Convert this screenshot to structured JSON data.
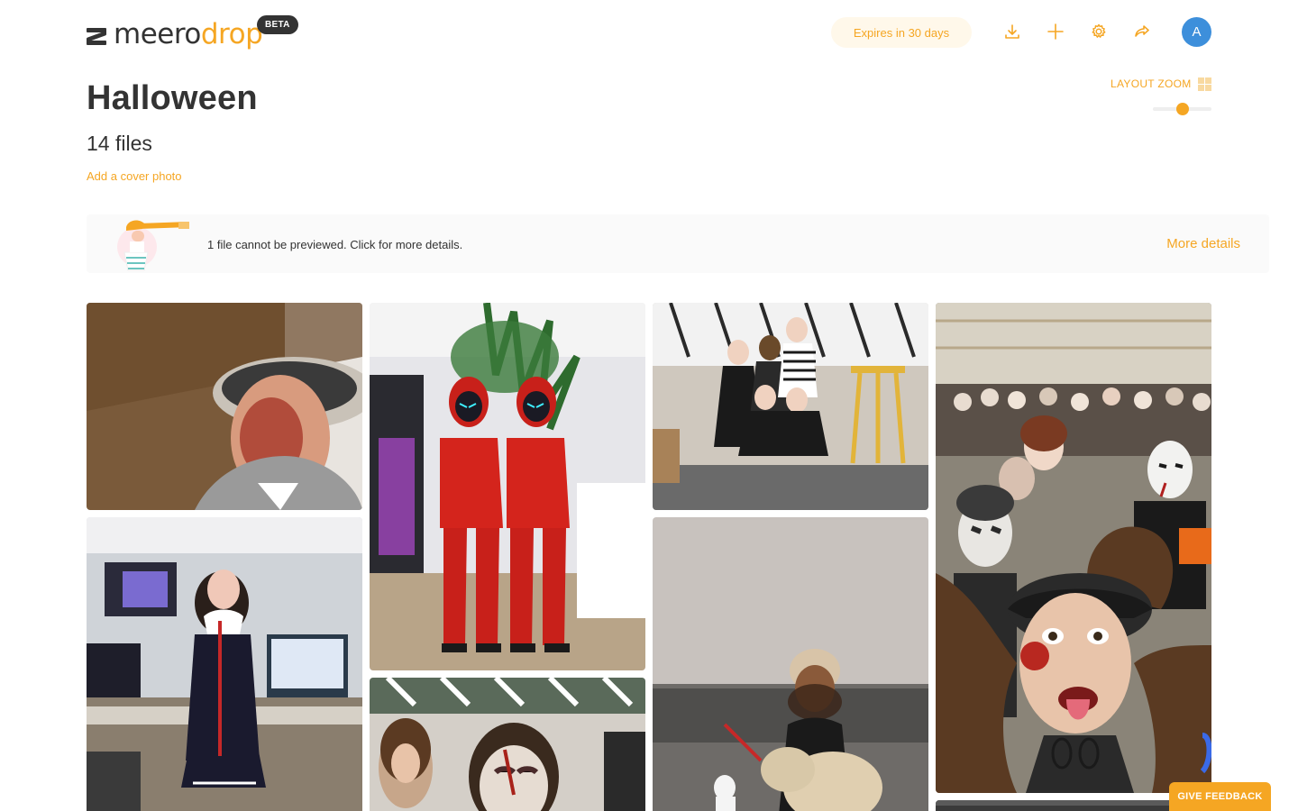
{
  "app": {
    "logo_primary": "meero",
    "logo_accent": "drop",
    "badge": "BETA"
  },
  "header": {
    "expires_label": "Expires in 30 days",
    "avatar_initial": "A",
    "icons": [
      "download-icon",
      "plus-icon",
      "settings-gear-icon",
      "share-icon"
    ]
  },
  "album": {
    "title": "Halloween",
    "file_count": "14 files",
    "cover_link": "Add a cover photo"
  },
  "layout_zoom": {
    "label": "LAYOUT ZOOM",
    "level": 0.5
  },
  "notice": {
    "message": "1 file cannot be previewed. Click for more details.",
    "action": "More details"
  },
  "photos": [
    {
      "subject": "man in bowler hat with bloody face makeup"
    },
    {
      "subject": "two people in red jumpsuits with LED masks"
    },
    {
      "subject": "group in Halloween costumes in office"
    },
    {
      "subject": "crowd of people in zombie makeup"
    },
    {
      "subject": "woman in clown costume in office"
    },
    {
      "subject": "woman in fur coat and hat"
    },
    {
      "subject": "people in zombie makeup"
    },
    {
      "subject": "crowd photo"
    }
  ],
  "feedback_label": "GIVE FEEDBACK",
  "colors": {
    "accent": "#f5a623",
    "text": "#333333",
    "avatar": "#3d8fdb"
  }
}
